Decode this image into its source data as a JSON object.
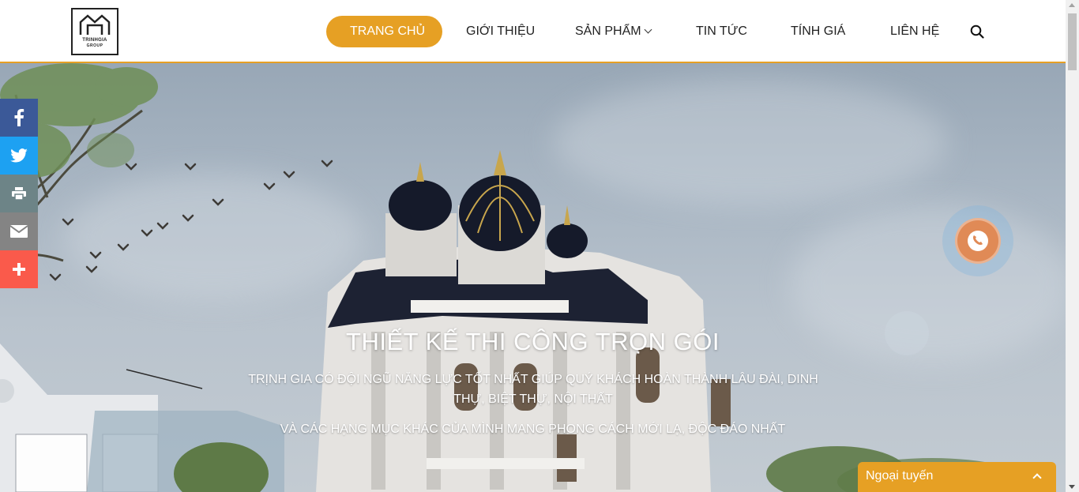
{
  "brand": {
    "logo_line1": "TRINHGIA",
    "logo_line2": "GROUP"
  },
  "nav": {
    "items": [
      {
        "label": "TRANG CHỦ",
        "active": true
      },
      {
        "label": "GIỚI THIỆU"
      },
      {
        "label": "SẢN PHẨM",
        "has_dropdown": true
      },
      {
        "label": "TIN TỨC"
      },
      {
        "label": "TÍNH GIÁ"
      },
      {
        "label": "LIÊN HỆ"
      }
    ],
    "search_icon": "search-icon"
  },
  "hero": {
    "title": "THIẾT KẾ THI CÔNG TRỌN GÓI",
    "subtitle": "TRỊNH GIA CÓ ĐỘI NGŨ NĂNG LỰC TỐT NHẤT GIÚP QUÝ KHÁCH HOÀN THÀNH LÂU ĐÀI, DINH THỰ, BIỆT THỰ, NỘI THẤT",
    "subtitle2": "VÀ CÁC HẠNG MỤC KHÁC CỦA MÌNH MANG PHONG CÁCH MỚI LẠ, ĐỘC ĐÁO NHẤT"
  },
  "social": [
    {
      "icon": "facebook-icon",
      "color": "#3b5998"
    },
    {
      "icon": "twitter-icon",
      "color": "#1da1f2"
    },
    {
      "icon": "print-icon",
      "color": "#6d8487"
    },
    {
      "icon": "email-icon",
      "color": "#848484"
    },
    {
      "icon": "plus-icon",
      "color": "#fa5a4b"
    }
  ],
  "chat": {
    "label": "Ngoại tuyến"
  },
  "colors": {
    "accent": "#e6a024",
    "phone": "#e08a56"
  }
}
